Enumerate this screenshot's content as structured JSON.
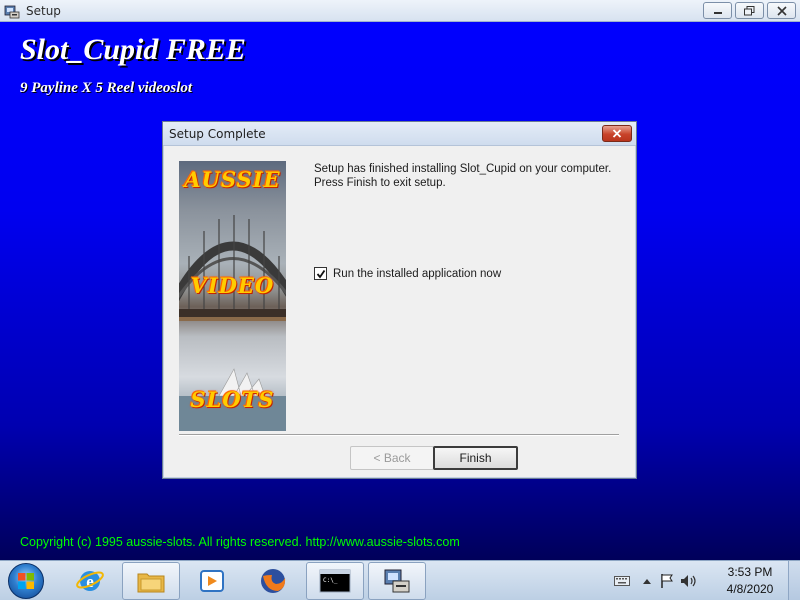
{
  "window": {
    "title": "Setup"
  },
  "product": {
    "title": "Slot_Cupid FREE",
    "subtitle": "9 Payline X 5 Reel videoslot"
  },
  "copyright": "Copyright (c) 1995 aussie-slots. All rights reserved. http://www.aussie-slots.com",
  "dialog": {
    "title": "Setup Complete",
    "message": "Setup has finished installing Slot_Cupid on your computer. Press Finish to exit setup.",
    "run_checkbox": {
      "label": "Run the installed application now",
      "checked": true
    },
    "back_label": "< Back",
    "finish_label": "Finish",
    "image_words": [
      "AUSSIE",
      "VIDEO",
      "SLOTS"
    ]
  },
  "taskbar": {
    "items": [
      "internet-explorer-icon",
      "file-explorer-icon",
      "media-player-icon",
      "firefox-icon",
      "command-prompt-icon",
      "setup-installer-icon"
    ],
    "clock": {
      "time": "3:53 PM",
      "date": "4/8/2020"
    }
  },
  "colors": {
    "backdrop_top": "#0000fe",
    "backdrop_bottom": "#00005a",
    "copyright": "#00ff00"
  }
}
